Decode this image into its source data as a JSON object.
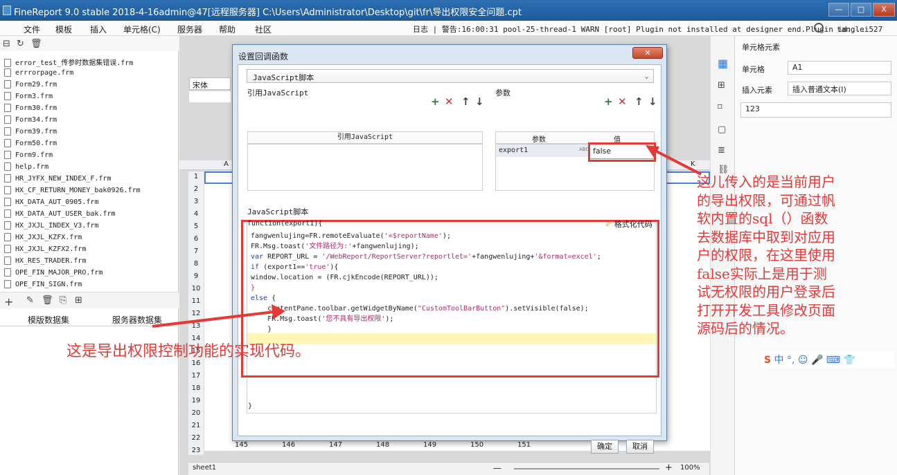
{
  "window": {
    "title": "FineReport 9.0 stable 2018-4-16admin@47[远程服务器]   C:\\Users\\Administrator\\Desktop\\git\\fr\\导出权限安全问题.cpt",
    "min": "—",
    "max": "□",
    "close": "X"
  },
  "menu": {
    "items": [
      "文件",
      "模板",
      "插入",
      "单元格(C)",
      "服务器",
      "帮助",
      "社区"
    ],
    "log": "日志 | 警告:16:00:31 pool-25-thread-1 WARN [root] Plugin not installed at designer end.Plugin id:...",
    "user": "tanglei527"
  },
  "left": {
    "files": [
      "error_test_传参时数据集错误.frm",
      "errrorpage.frm",
      "Form29.frm",
      "Form3.frm",
      "Form30.frm",
      "Form34.frm",
      "Form39.frm",
      "Form50.frm",
      "Form9.frm",
      "help.frm",
      "HR_JYFX_NEW_INDEX_F.frm",
      "HX_CF_RETURN_MONEY_bak0926.frm",
      "HX_DATA_AUT_0905.frm",
      "HX_DATA_AUT_USER_bak.frm",
      "HX_JXJL_INDEX_V3.frm",
      "HX_JXJL_KZFX.frm",
      "HX_JXJL_KZFX2.frm",
      "HX_RES_TRADER.frm",
      "OPE_FIN_MAJOR_PRO.frm",
      "OPE_FIN_SIGN.frm"
    ],
    "tab_template": "模版数据集",
    "tab_server": "服务器数据集"
  },
  "canvas": {
    "font": "宋体",
    "rows": [
      "1",
      "2",
      "3",
      "4",
      "5",
      "6",
      "7",
      "8",
      "9",
      "10",
      "11",
      "12",
      "13",
      "14",
      "15",
      "16",
      "17",
      "18",
      "19",
      "20",
      "21",
      "22",
      "23"
    ],
    "cols": [
      "145",
      "146",
      "147",
      "148",
      "149",
      "150",
      "151"
    ],
    "col_a": "A",
    "col_k": "K",
    "sheet": "sheet1",
    "zoom": "100%",
    "zoom_plus": "+",
    "zoom_minus": "—"
  },
  "right": {
    "title": "单元格元素",
    "cell_label": "单元格",
    "cell_value": "A1",
    "insert_label": "插入元素",
    "insert_value": "插入普通文本(I)",
    "content": "123"
  },
  "dialog": {
    "title": "设置回调函数",
    "type": "JavaScript脚本",
    "ref_label": "引用JavaScript",
    "param_label": "参数",
    "ref_header": "引用JavaScript",
    "param_col": "参数",
    "value_col": "值",
    "param_name": "export1",
    "param_type": "ABC",
    "param_value": "false",
    "script_label": "JavaScript脚本",
    "fn_signature": "function(export1){",
    "format_btn": "格式化代码",
    "code": {
      "l1a": "fangwenlujing=FR.remoteEvaluate(",
      "l1s": "'=$reportName'",
      "l1b": ");",
      "l2a": "FR.Msg.toast(",
      "l2s": "'文件路径为:'",
      "l2b": "+fangwenlujing);",
      "l3k": "var",
      "l3a": " REPORT_URL = ",
      "l3s1": "'/WebReport/ReportServer?reportlet='",
      "l3b": "+fangwenlujing+",
      "l3s2": "'&format=excel'",
      "l3c": ";",
      "l4k": "if",
      "l4a": " (export1==",
      "l4s": "'true'",
      "l4b": "){",
      "l5": "window.location = (FR.cjkEncode(REPORT_URL));",
      "l6": "}",
      "l7k": "else",
      "l7b": " {",
      "l8a": "    contentPane.toolbar.getWidgetByName(",
      "l8s": "\"CustomToolBarButton\"",
      "l8b": ").setVisible(false);",
      "l9a": "    FR.Msg.toast(",
      "l9s": "'您不具有导出权限'",
      "l9b": ");",
      "l10": "    }",
      "close": "}"
    },
    "ok": "确定",
    "cancel": "取消"
  },
  "annotations": {
    "right_lines": [
      "这儿传入的是当前用户",
      "的导出权限，可通过帆",
      "软内置的sql（）函数",
      "去数据库中取到对应用",
      "户的权限，在这里使用",
      "false实际上是用于测",
      "试无权限的用户登录后",
      "打开开发工具修改页面",
      "源码后的情况。"
    ],
    "left_text": "这是导出权限控制功能的实现代码。",
    "color": "#e53935"
  },
  "ime": "中"
}
